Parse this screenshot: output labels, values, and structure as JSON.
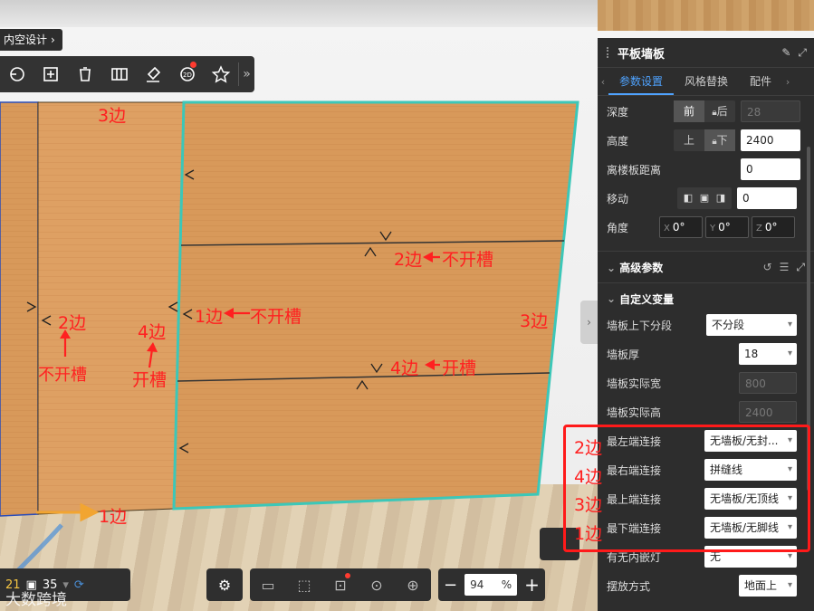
{
  "app": {
    "breadcrumb": "内空设计",
    "breadcrumb_arrow": "›"
  },
  "toolbar": {
    "items": [
      "rotate-view-icon",
      "add-panel-icon",
      "delete-icon",
      "split-panel-icon",
      "brush-icon",
      "view-2d-icon",
      "favorite-icon"
    ],
    "more": "»"
  },
  "bottom_left": {
    "count_a": "21",
    "count_b": "35"
  },
  "bottom": {
    "zoom_value": "94",
    "zoom_unit": "%",
    "minus": "−",
    "plus": "+"
  },
  "panel": {
    "title": "平板墙板",
    "tabs": [
      {
        "label": "参数设置",
        "active": true
      },
      {
        "label": "风格替换",
        "active": false
      },
      {
        "label": "配件",
        "active": false
      }
    ],
    "depth": {
      "label": "深度",
      "opt_front": "前",
      "opt_back": "后",
      "value": "28"
    },
    "height": {
      "label": "高度",
      "opt_up": "上",
      "opt_down": "下",
      "value": "2400"
    },
    "floor_distance": {
      "label": "离楼板距离",
      "value": "0"
    },
    "move": {
      "label": "移动",
      "value": "0"
    },
    "angle": {
      "label": "角度",
      "x": "0°",
      "y": "0°",
      "z": "0°"
    },
    "advanced": {
      "title": "高级参数"
    },
    "custom_vars": {
      "title": "自定义变量"
    },
    "params": [
      {
        "label": "墙板上下分段",
        "value": "不分段",
        "type": "select"
      },
      {
        "label": "墙板厚",
        "value": "18",
        "type": "select"
      },
      {
        "label": "墙板实际宽",
        "value": "800",
        "type": "disabled"
      },
      {
        "label": "墙板实际高",
        "value": "2400",
        "type": "disabled"
      },
      {
        "label": "最左端连接",
        "value": "无墙板/无封...",
        "type": "select"
      },
      {
        "label": "最右端连接",
        "value": "拼缝线",
        "type": "select"
      },
      {
        "label": "最上端连接",
        "value": "无墙板/无顶线",
        "type": "select"
      },
      {
        "label": "最下端连接",
        "value": "无墙板/无脚线",
        "type": "select"
      },
      {
        "label": "有无内嵌灯",
        "value": "无",
        "type": "select"
      },
      {
        "label": "摆放方式",
        "value": "地面上",
        "type": "select"
      }
    ]
  },
  "annotations": {
    "top_left": "3边",
    "left_2": "2边",
    "left_no_slot": "不开槽",
    "left_4": "4边",
    "left_slot": "开槽",
    "bottom_1": "1边",
    "mid_1": "1边",
    "mid_1_no_slot": "不开槽",
    "upper_2": "2边",
    "upper_2_no_slot": "不开槽",
    "lower_4": "4边",
    "lower_4_slot": "开槽",
    "right_3": "3边",
    "box_2": "2边",
    "box_4": "4边",
    "box_3": "3边",
    "box_1": "1边"
  },
  "watermark": "大数跨境"
}
